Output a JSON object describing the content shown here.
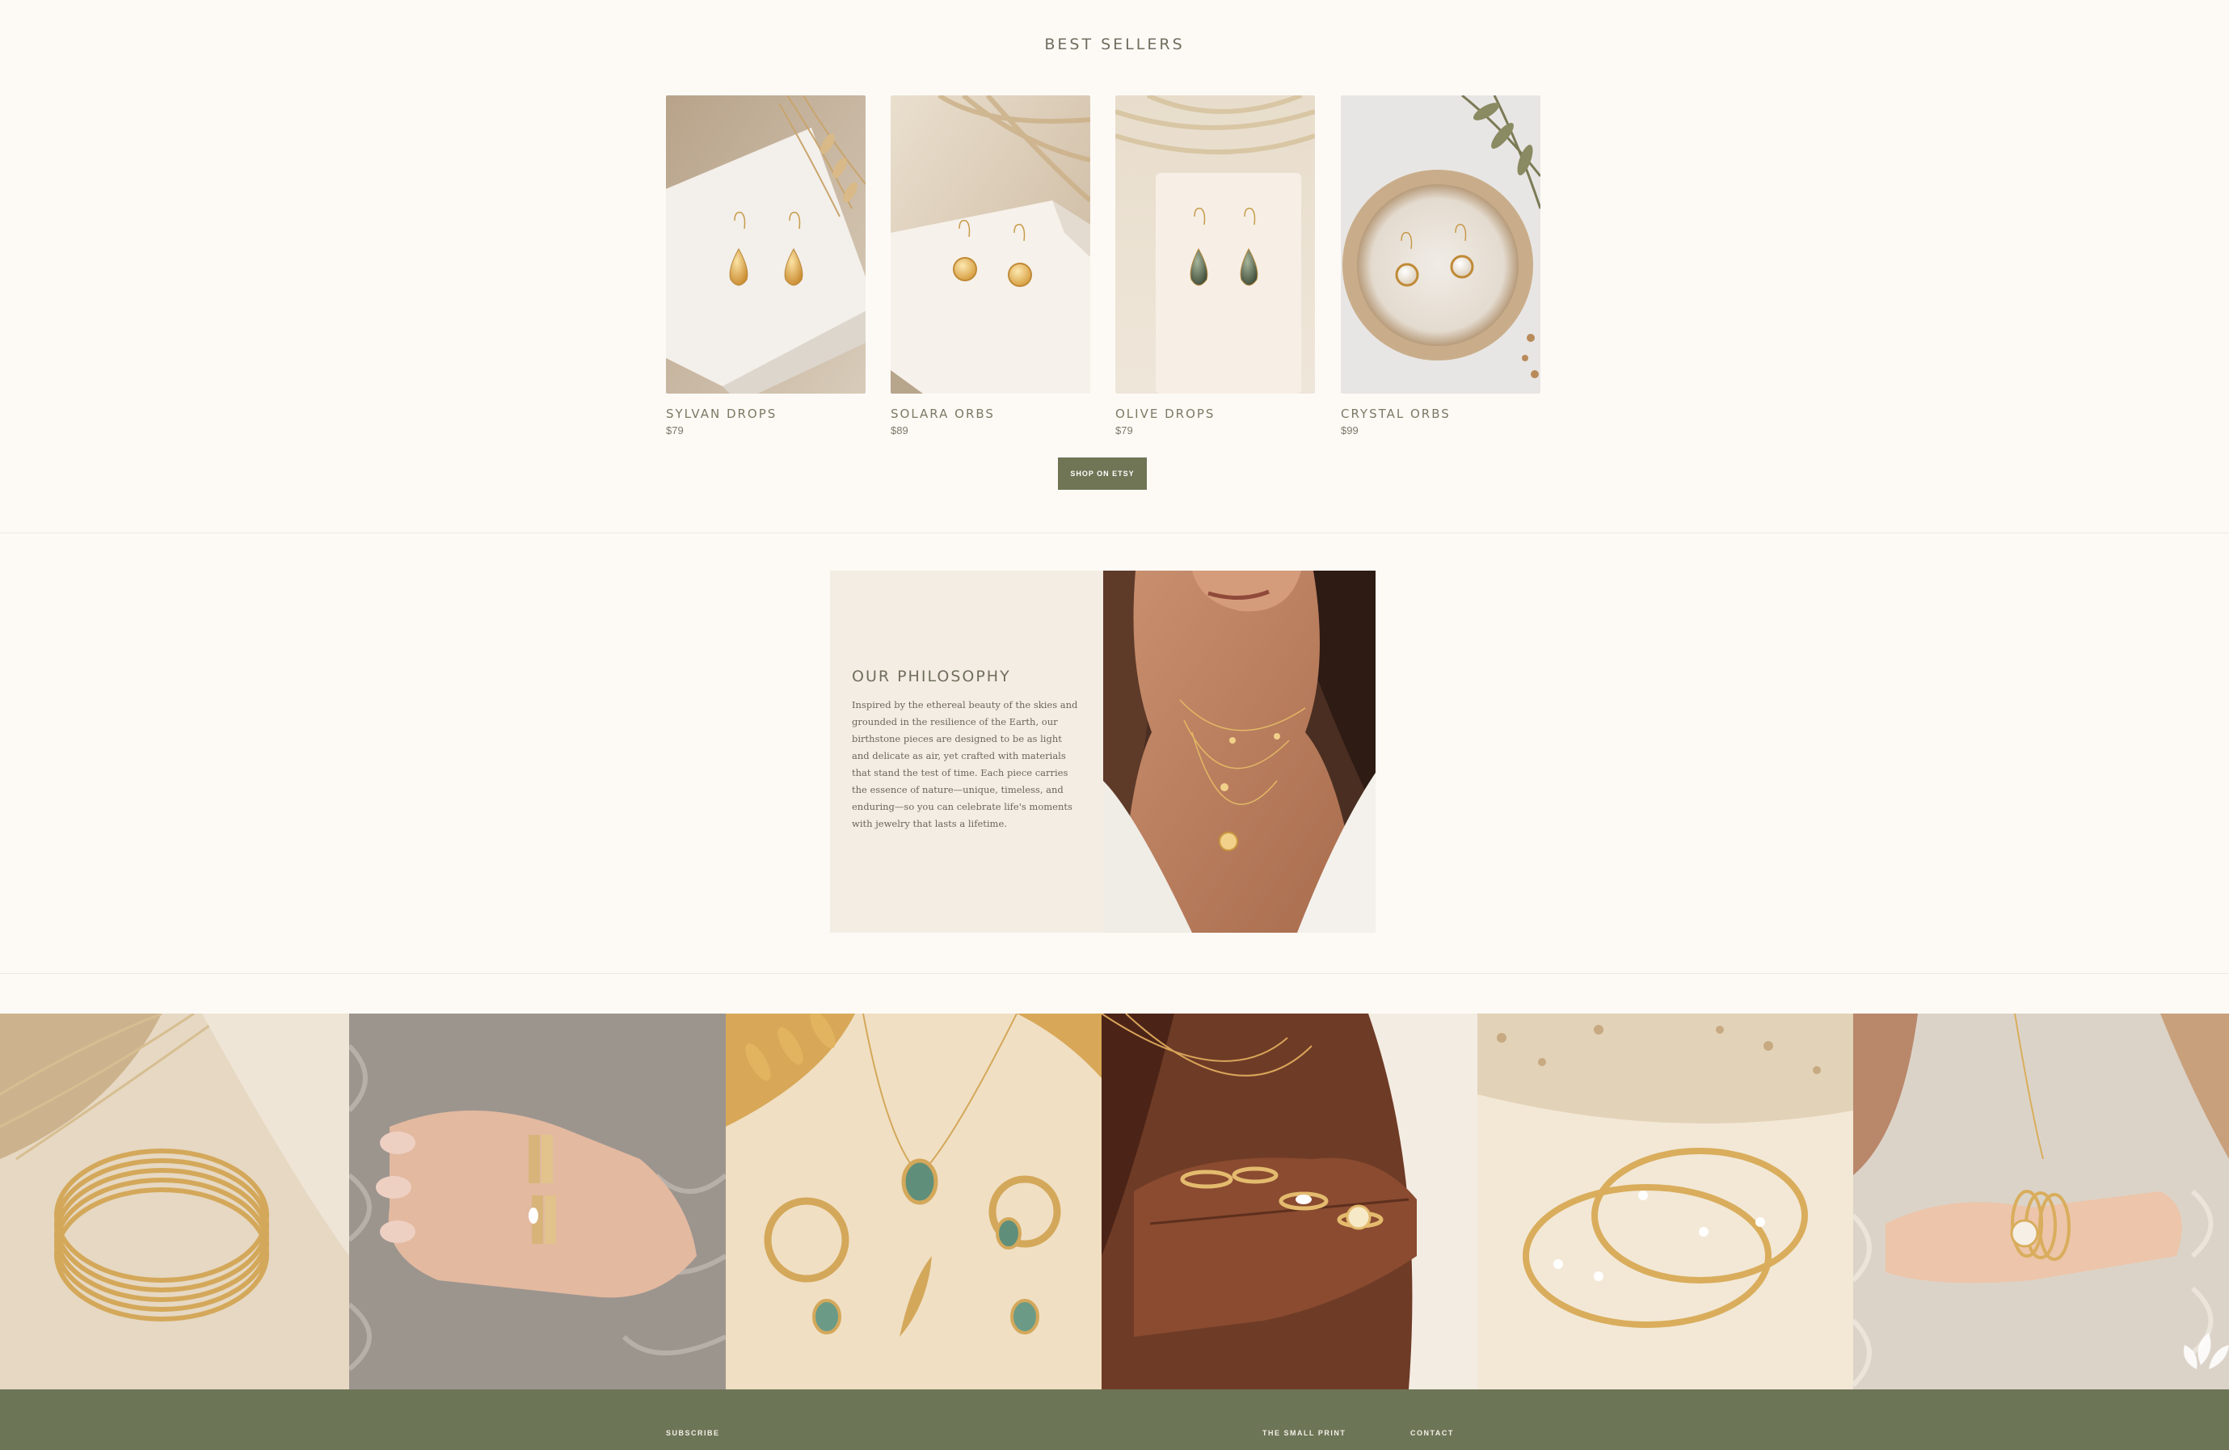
{
  "best_sellers": {
    "title": "BEST SELLERS",
    "products": [
      {
        "name": "SYLVAN DROPS",
        "price": "$79"
      },
      {
        "name": "SOLARA ORBS",
        "price": "$89"
      },
      {
        "name": "OLIVE DROPS",
        "price": "$79"
      },
      {
        "name": "CRYSTAL ORBS",
        "price": "$99"
      }
    ],
    "cta_label": "SHOP ON ETSY"
  },
  "philosophy": {
    "title": "OUR PHILOSOPHY",
    "body": "Inspired by the ethereal beauty of the skies and grounded in the resilience of the Earth, our birthstone pieces are designed to be as light and delicate as air, yet crafted with materials that stand the test of time. Each piece carries the essence of nature—unique, timeless, and enduring—so you can celebrate life's moments with jewelry that lasts a lifetime."
  },
  "footer": {
    "subscribe_label": "SUBSCRIBE",
    "small_print_label": "THE SMALL PRINT",
    "contact_label": "CONTACT"
  },
  "colors": {
    "background": "#fdfaf6",
    "accent_olive": "#6f7555",
    "philosophy_card": "#f4ede4"
  }
}
